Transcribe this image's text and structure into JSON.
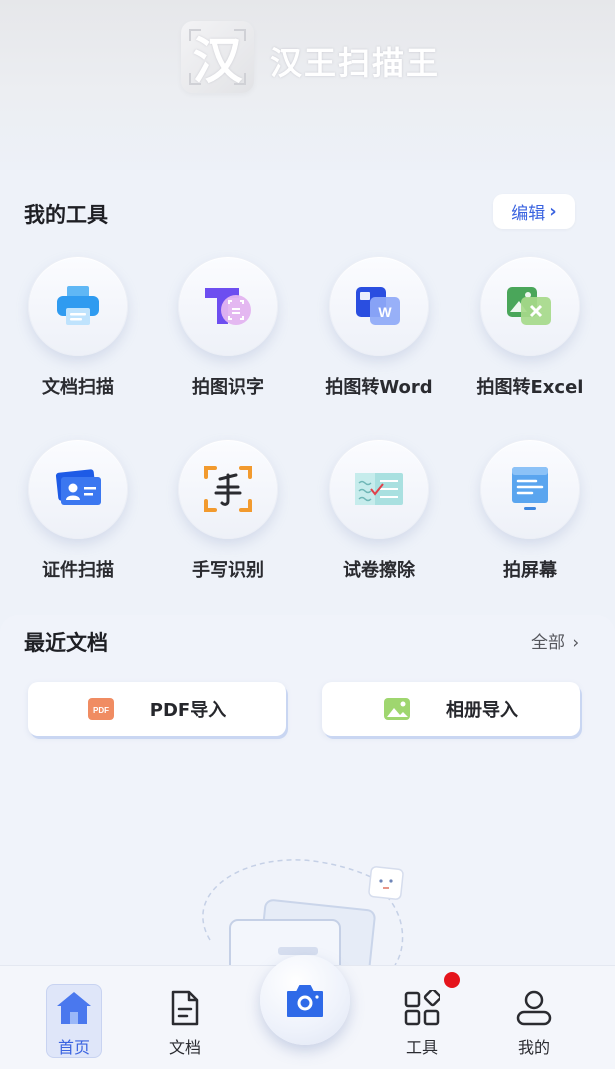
{
  "header": {
    "logo_char": "汉",
    "app_title": "汉王扫描王"
  },
  "tools_section": {
    "title": "我的工具",
    "edit_label": "编辑",
    "items": [
      {
        "label": "文档扫描",
        "icon": "printer-icon"
      },
      {
        "label": "拍图识字",
        "icon": "text-recognition-icon"
      },
      {
        "label": "拍图转Word",
        "icon": "word-icon"
      },
      {
        "label": "拍图转Excel",
        "icon": "excel-icon"
      },
      {
        "label": "证件扫描",
        "icon": "id-card-icon"
      },
      {
        "label": "手写识别",
        "icon": "handwriting-icon"
      },
      {
        "label": "试卷擦除",
        "icon": "paper-erase-icon"
      },
      {
        "label": "拍屏幕",
        "icon": "screen-capture-icon"
      }
    ]
  },
  "recent_section": {
    "title": "最近文档",
    "all_label": "全部",
    "pdf_import": {
      "label": "PDF导入",
      "icon_text": "PDF"
    },
    "album_import": {
      "label": "相册导入"
    }
  },
  "tabbar": {
    "home": "首页",
    "docs": "文档",
    "tools": "工具",
    "mine": "我的",
    "camera_icon": "camera-icon"
  },
  "colors": {
    "accent": "#3a63e0",
    "badge": "#e5141c",
    "background": "#eef2f9"
  }
}
